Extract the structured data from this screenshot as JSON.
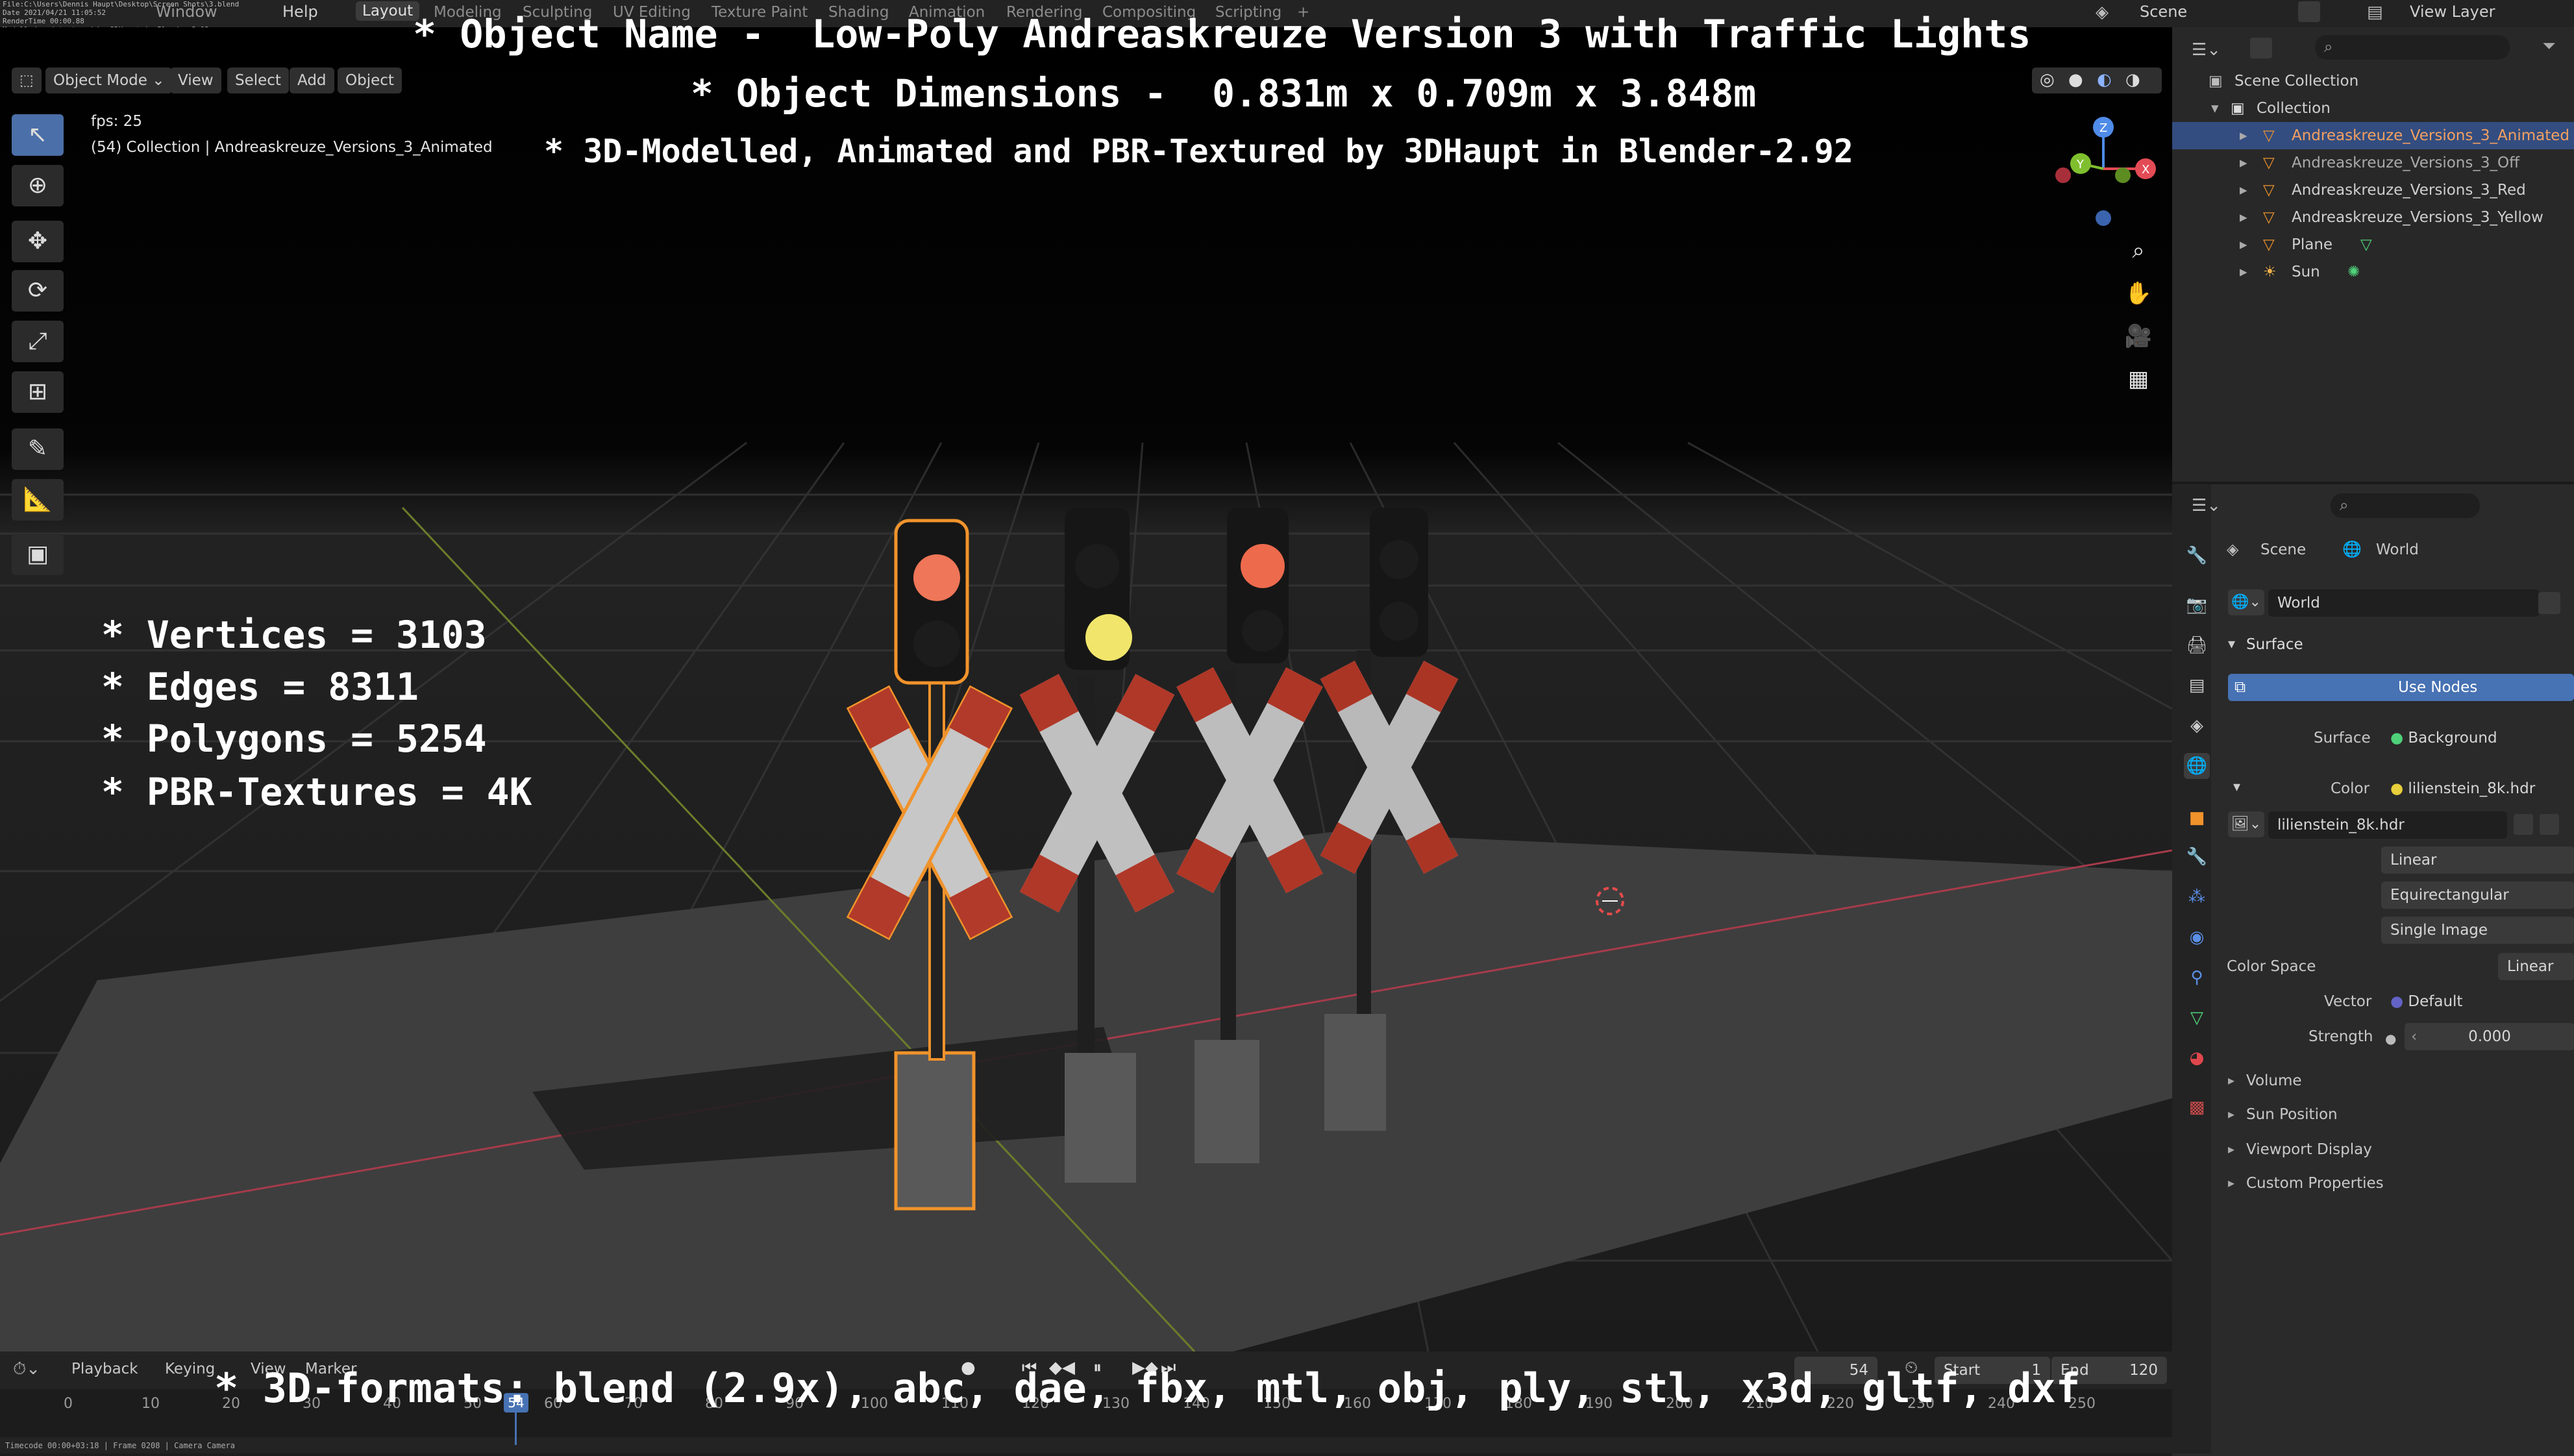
{
  "meta": {
    "lines": [
      "File:C:\\Users\\Dennis Haupt\\Desktop\\Screen Shots\\3.blend",
      "Date 2021/04/21 11:05:52",
      "RenderTime 00:00.88",
      "Modelled and textured by 3DHaupt in Blender-2.92"
    ]
  },
  "topbar": {
    "menus": [
      "File",
      "Edit",
      "Render",
      "Window",
      "Help"
    ],
    "workspaces": [
      "Layout",
      "Modeling",
      "Sculpting",
      "UV Editing",
      "Texture Paint",
      "Shading",
      "Animation",
      "Rendering",
      "Compositing",
      "Scripting"
    ],
    "active_workspace": "Layout",
    "add_tab": "+",
    "scene": "Scene",
    "view_layer": "View Layer"
  },
  "viewport": {
    "mode": "Object Mode",
    "menus": [
      "View",
      "Select",
      "Add",
      "Object"
    ],
    "fps": "fps: 25",
    "collection_info": "(54) Collection | Andreaskreuze_Versions_3_Animated",
    "gizmo_axes": [
      "Z",
      "Y",
      "X"
    ]
  },
  "overlay": {
    "title_line1": "* Object Name -  Low-Poly Andreaskreuze Version 3 with Traffic Lights",
    "title_line2": "* Object Dimensions -  0.831m x 0.709m x 3.848m",
    "title_line3": "* 3D-Modelled, Animated and PBR-Textured by 3DHaupt in Blender-2.92",
    "stats": [
      "* Vertices = 3103",
      "* Edges = 8311",
      "* Polygons = 5254",
      "* PBR-Textures = 4K"
    ],
    "formats": "* 3D-formats: blend (2.9x), abc, dae, fbx, mtl, obj, ply, stl, x3d, gltf, dxf"
  },
  "outliner": {
    "scene_collection": "Scene Collection",
    "collection": "Collection",
    "items": [
      {
        "label": "Andreaskreuze_Versions_3_Animated",
        "selected": true
      },
      {
        "label": "Andreaskreuze_Versions_3_Off",
        "selected": false
      },
      {
        "label": "Andreaskreuze_Versions_3_Red",
        "selected": false
      },
      {
        "label": "Andreaskreuze_Versions_3_Yellow",
        "selected": false
      },
      {
        "label": "Plane",
        "selected": false
      },
      {
        "label": "Sun",
        "selected": false
      }
    ]
  },
  "properties": {
    "breadcrumb_scene": "Scene",
    "breadcrumb_world": "World",
    "world_name": "World",
    "surface_header": "Surface",
    "use_nodes": "Use Nodes",
    "surface_label": "Surface",
    "surface_value": "Background",
    "color_label": "Color",
    "color_value": "lilienstein_8k.hdr",
    "image_name": "lilienstein_8k.hdr",
    "interpolation": "Linear",
    "projection": "Equirectangular",
    "source": "Single Image",
    "color_space_label": "Color Space",
    "color_space_value": "Linear",
    "vector_label": "Vector",
    "vector_value": "Default",
    "strength_label": "Strength",
    "strength_value": "0.000",
    "panels": [
      "Volume",
      "Sun Position",
      "Viewport Display",
      "Custom Properties"
    ]
  },
  "timeline": {
    "menus": [
      "Playback",
      "Keying",
      "View",
      "Marker"
    ],
    "current_frame": "54",
    "start_label": "Start",
    "start_value": "1",
    "end_label": "End",
    "end_value": "120",
    "ticks": [
      "0",
      "10",
      "20",
      "30",
      "40",
      "50",
      "60",
      "70",
      "80",
      "90",
      "100",
      "110",
      "120",
      "130",
      "140",
      "150",
      "160",
      "170",
      "180",
      "190",
      "200",
      "210",
      "220",
      "230",
      "240",
      "250"
    ],
    "status": "Timecode 00:00+03:18 | Frame 0208 | Camera Camera"
  }
}
